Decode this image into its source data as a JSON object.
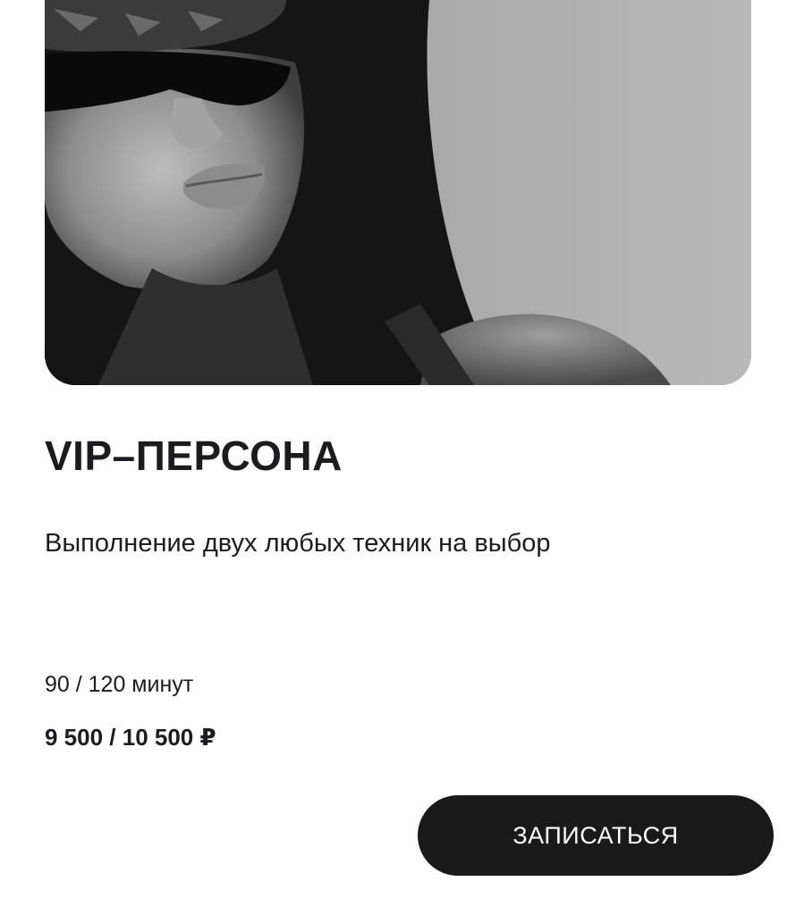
{
  "service": {
    "title": "VIP–ПЕРСОНА",
    "description": "Выполнение двух любых техник на выбор",
    "duration": "90 / 120 минут",
    "price": "9 500 / 10 500 ₽",
    "book_label": "ЗАПИСАТЬСЯ"
  },
  "photo": {
    "subject": "black-and-white portrait of a woman in sunglasses and cap"
  }
}
